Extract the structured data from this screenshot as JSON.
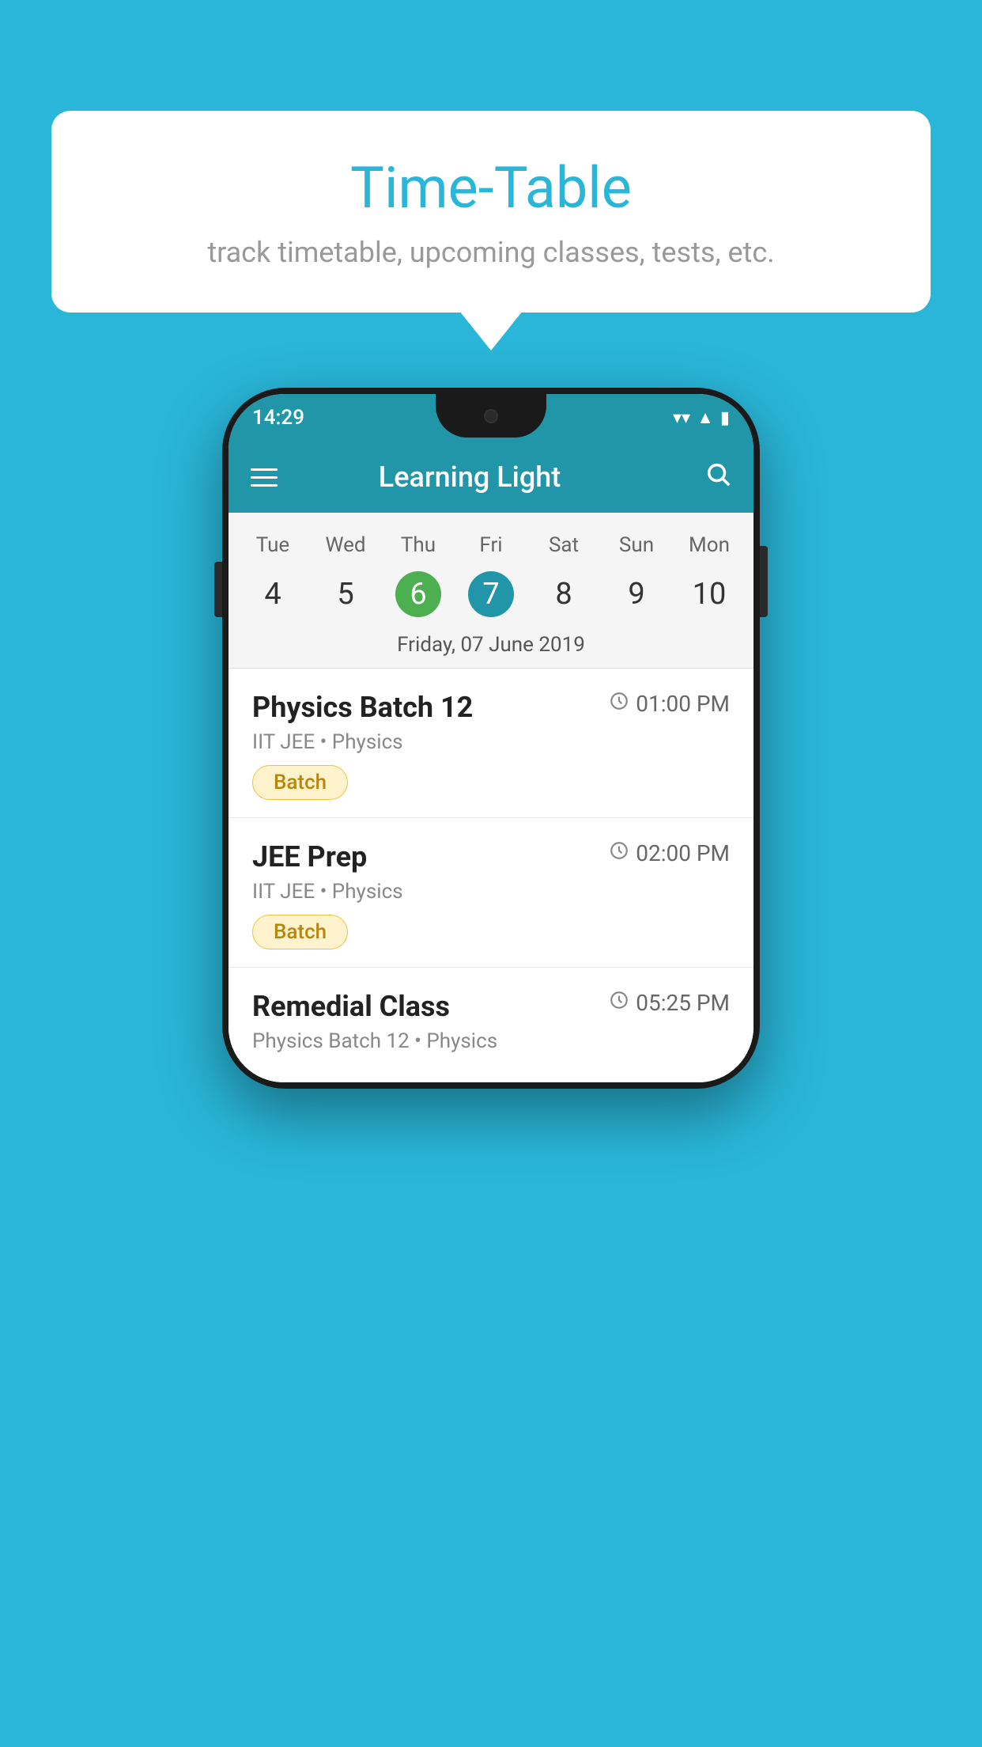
{
  "background_color": "#29B6D8",
  "bubble": {
    "title": "Time-Table",
    "subtitle": "track timetable, upcoming classes, tests, etc."
  },
  "app": {
    "title": "Learning Light",
    "status_time": "14:29"
  },
  "calendar": {
    "days": [
      {
        "label": "Tue",
        "num": "4",
        "state": "normal"
      },
      {
        "label": "Wed",
        "num": "5",
        "state": "normal"
      },
      {
        "label": "Thu",
        "num": "6",
        "state": "today"
      },
      {
        "label": "Fri",
        "num": "7",
        "state": "selected"
      },
      {
        "label": "Sat",
        "num": "8",
        "state": "normal"
      },
      {
        "label": "Sun",
        "num": "9",
        "state": "normal"
      },
      {
        "label": "Mon",
        "num": "10",
        "state": "normal"
      }
    ],
    "selected_date": "Friday, 07 June 2019"
  },
  "classes": [
    {
      "name": "Physics Batch 12",
      "time": "01:00 PM",
      "meta": "IIT JEE • Physics",
      "badge": "Batch"
    },
    {
      "name": "JEE Prep",
      "time": "02:00 PM",
      "meta": "IIT JEE • Physics",
      "badge": "Batch"
    },
    {
      "name": "Remedial Class",
      "time": "05:25 PM",
      "meta": "Physics Batch 12 • Physics",
      "badge": null
    }
  ]
}
